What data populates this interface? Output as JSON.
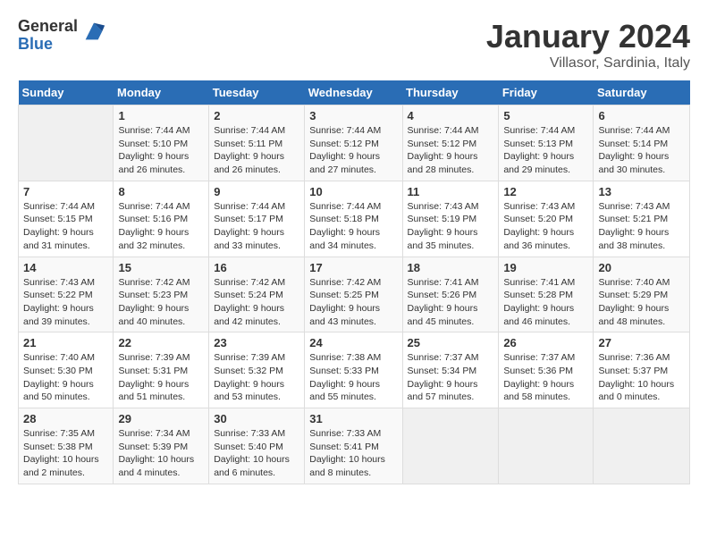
{
  "logo": {
    "general": "General",
    "blue": "Blue"
  },
  "title": "January 2024",
  "subtitle": "Villasor, Sardinia, Italy",
  "days_of_week": [
    "Sunday",
    "Monday",
    "Tuesday",
    "Wednesday",
    "Thursday",
    "Friday",
    "Saturday"
  ],
  "weeks": [
    [
      {
        "day": "",
        "info": ""
      },
      {
        "day": "1",
        "info": "Sunrise: 7:44 AM\nSunset: 5:10 PM\nDaylight: 9 hours\nand 26 minutes."
      },
      {
        "day": "2",
        "info": "Sunrise: 7:44 AM\nSunset: 5:11 PM\nDaylight: 9 hours\nand 26 minutes."
      },
      {
        "day": "3",
        "info": "Sunrise: 7:44 AM\nSunset: 5:12 PM\nDaylight: 9 hours\nand 27 minutes."
      },
      {
        "day": "4",
        "info": "Sunrise: 7:44 AM\nSunset: 5:12 PM\nDaylight: 9 hours\nand 28 minutes."
      },
      {
        "day": "5",
        "info": "Sunrise: 7:44 AM\nSunset: 5:13 PM\nDaylight: 9 hours\nand 29 minutes."
      },
      {
        "day": "6",
        "info": "Sunrise: 7:44 AM\nSunset: 5:14 PM\nDaylight: 9 hours\nand 30 minutes."
      }
    ],
    [
      {
        "day": "7",
        "info": "Sunrise: 7:44 AM\nSunset: 5:15 PM\nDaylight: 9 hours\nand 31 minutes."
      },
      {
        "day": "8",
        "info": "Sunrise: 7:44 AM\nSunset: 5:16 PM\nDaylight: 9 hours\nand 32 minutes."
      },
      {
        "day": "9",
        "info": "Sunrise: 7:44 AM\nSunset: 5:17 PM\nDaylight: 9 hours\nand 33 minutes."
      },
      {
        "day": "10",
        "info": "Sunrise: 7:44 AM\nSunset: 5:18 PM\nDaylight: 9 hours\nand 34 minutes."
      },
      {
        "day": "11",
        "info": "Sunrise: 7:43 AM\nSunset: 5:19 PM\nDaylight: 9 hours\nand 35 minutes."
      },
      {
        "day": "12",
        "info": "Sunrise: 7:43 AM\nSunset: 5:20 PM\nDaylight: 9 hours\nand 36 minutes."
      },
      {
        "day": "13",
        "info": "Sunrise: 7:43 AM\nSunset: 5:21 PM\nDaylight: 9 hours\nand 38 minutes."
      }
    ],
    [
      {
        "day": "14",
        "info": "Sunrise: 7:43 AM\nSunset: 5:22 PM\nDaylight: 9 hours\nand 39 minutes."
      },
      {
        "day": "15",
        "info": "Sunrise: 7:42 AM\nSunset: 5:23 PM\nDaylight: 9 hours\nand 40 minutes."
      },
      {
        "day": "16",
        "info": "Sunrise: 7:42 AM\nSunset: 5:24 PM\nDaylight: 9 hours\nand 42 minutes."
      },
      {
        "day": "17",
        "info": "Sunrise: 7:42 AM\nSunset: 5:25 PM\nDaylight: 9 hours\nand 43 minutes."
      },
      {
        "day": "18",
        "info": "Sunrise: 7:41 AM\nSunset: 5:26 PM\nDaylight: 9 hours\nand 45 minutes."
      },
      {
        "day": "19",
        "info": "Sunrise: 7:41 AM\nSunset: 5:28 PM\nDaylight: 9 hours\nand 46 minutes."
      },
      {
        "day": "20",
        "info": "Sunrise: 7:40 AM\nSunset: 5:29 PM\nDaylight: 9 hours\nand 48 minutes."
      }
    ],
    [
      {
        "day": "21",
        "info": "Sunrise: 7:40 AM\nSunset: 5:30 PM\nDaylight: 9 hours\nand 50 minutes."
      },
      {
        "day": "22",
        "info": "Sunrise: 7:39 AM\nSunset: 5:31 PM\nDaylight: 9 hours\nand 51 minutes."
      },
      {
        "day": "23",
        "info": "Sunrise: 7:39 AM\nSunset: 5:32 PM\nDaylight: 9 hours\nand 53 minutes."
      },
      {
        "day": "24",
        "info": "Sunrise: 7:38 AM\nSunset: 5:33 PM\nDaylight: 9 hours\nand 55 minutes."
      },
      {
        "day": "25",
        "info": "Sunrise: 7:37 AM\nSunset: 5:34 PM\nDaylight: 9 hours\nand 57 minutes."
      },
      {
        "day": "26",
        "info": "Sunrise: 7:37 AM\nSunset: 5:36 PM\nDaylight: 9 hours\nand 58 minutes."
      },
      {
        "day": "27",
        "info": "Sunrise: 7:36 AM\nSunset: 5:37 PM\nDaylight: 10 hours\nand 0 minutes."
      }
    ],
    [
      {
        "day": "28",
        "info": "Sunrise: 7:35 AM\nSunset: 5:38 PM\nDaylight: 10 hours\nand 2 minutes."
      },
      {
        "day": "29",
        "info": "Sunrise: 7:34 AM\nSunset: 5:39 PM\nDaylight: 10 hours\nand 4 minutes."
      },
      {
        "day": "30",
        "info": "Sunrise: 7:33 AM\nSunset: 5:40 PM\nDaylight: 10 hours\nand 6 minutes."
      },
      {
        "day": "31",
        "info": "Sunrise: 7:33 AM\nSunset: 5:41 PM\nDaylight: 10 hours\nand 8 minutes."
      },
      {
        "day": "",
        "info": ""
      },
      {
        "day": "",
        "info": ""
      },
      {
        "day": "",
        "info": ""
      }
    ]
  ]
}
